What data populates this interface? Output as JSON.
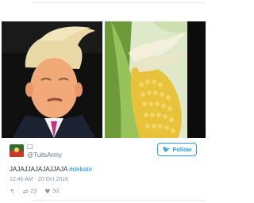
{
  "tweet": {
    "images": [
      {
        "icon": "portrait-photo",
        "alt_icon": "person-windblown-hair"
      },
      {
        "icon": "corn-cob-photo"
      }
    ],
    "author": {
      "avatar_icon": "avatar-icon",
      "display_name_icon": "small-glyph-icon",
      "display_name_glyph": "□",
      "handle": "@TuitsArmy"
    },
    "follow_button": {
      "label": "Follow",
      "icon": "twitter-bird-icon"
    },
    "text": {
      "body": "JAJAJJAJAJAJJAJA",
      "hashtag": "#debate"
    },
    "timestamp": "12:46 AM - 20 Oct 2016",
    "actions": {
      "reply_icon": "reply-icon",
      "retweet_icon": "retweet-icon",
      "retweet_count": "23",
      "like_icon": "heart-icon",
      "like_count": "50"
    },
    "colors": {
      "accent": "#1da1f2",
      "hashtag": "#1b95e0",
      "muted": "#8899a6",
      "text": "#292f33"
    }
  }
}
